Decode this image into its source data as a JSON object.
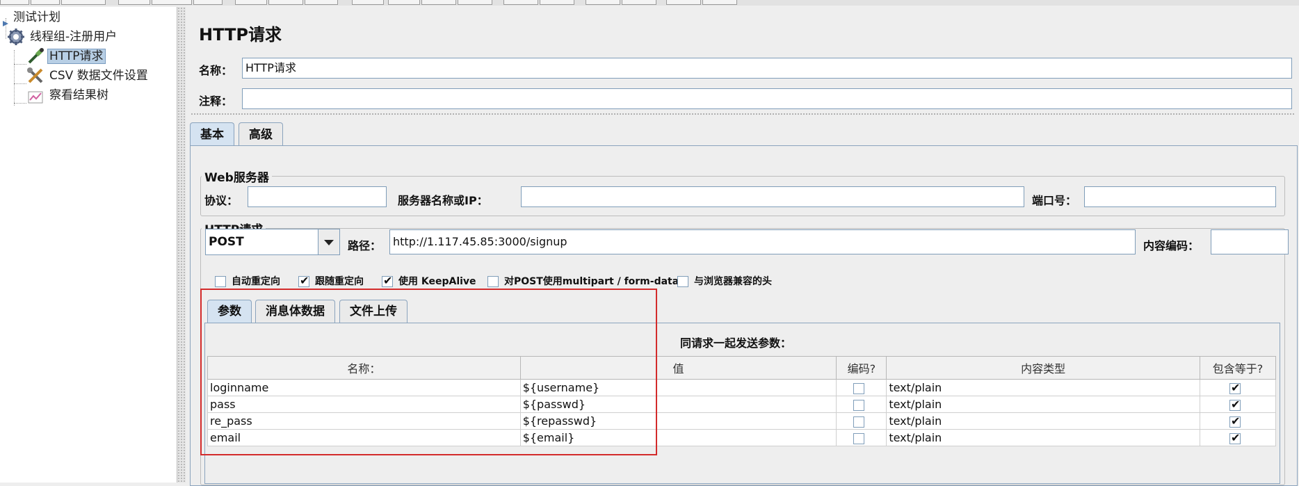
{
  "tree": {
    "root": "测试计划",
    "thread_group": "线程组-注册用户",
    "http_request": "HTTP请求",
    "csv": "CSV 数据文件设置",
    "result_tree": "察看结果树"
  },
  "form": {
    "title": "HTTP请求",
    "name_label": "名称：",
    "name_value": "HTTP请求",
    "comment_label": "注释：",
    "comment_value": ""
  },
  "main_tabs": {
    "basic": "基本",
    "advanced": "高级"
  },
  "web_server": {
    "title": "Web服务器",
    "protocol_label": "协议：",
    "protocol_value": "",
    "server_label": "服务器名称或IP：",
    "server_value": "",
    "port_label": "端口号：",
    "port_value": ""
  },
  "http_request": {
    "title": "HTTP请求",
    "method": "POST",
    "path_label": "路径：",
    "path_value": "http://1.117.45.85:3000/signup",
    "encoding_label": "内容编码：",
    "encoding_value": ""
  },
  "options": [
    {
      "label": "自动重定向",
      "checked": false
    },
    {
      "label": "跟随重定向",
      "checked": true
    },
    {
      "label": "使用 KeepAlive",
      "checked": true
    },
    {
      "label": "对POST使用multipart / form-data",
      "checked": false
    },
    {
      "label": "与浏览器兼容的头",
      "checked": false
    }
  ],
  "sub_tabs": {
    "params": "参数",
    "body": "消息体数据",
    "files": "文件上传"
  },
  "params": {
    "caption": "同请求一起发送参数：",
    "headers": {
      "name": "名称：",
      "value": "值",
      "encode": "编码?",
      "content_type": "内容类型",
      "include_equals": "包含等于?"
    },
    "rows": [
      {
        "name": "loginname",
        "value": "${username}",
        "encode": false,
        "content_type": "text/plain",
        "include_equals": true
      },
      {
        "name": "pass",
        "value": "${passwd}",
        "encode": false,
        "content_type": "text/plain",
        "include_equals": true
      },
      {
        "name": "re_pass",
        "value": "${repasswd}",
        "encode": false,
        "content_type": "text/plain",
        "include_equals": true
      },
      {
        "name": "email",
        "value": "${email}",
        "encode": false,
        "content_type": "text/plain",
        "include_equals": true
      }
    ]
  },
  "colors": {
    "highlight": "#d32b2b",
    "selection": "#b8cfe5",
    "tab_active": "#d5e3f1"
  }
}
